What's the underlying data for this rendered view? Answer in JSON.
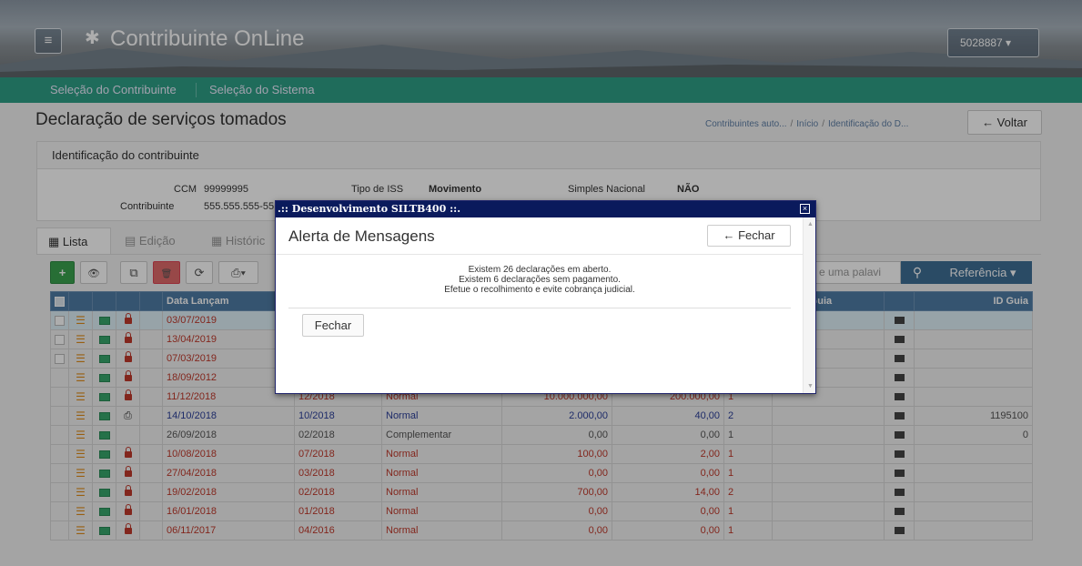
{
  "header": {
    "brand": "Contribuinte OnLine",
    "user": "5028887 ▾",
    "menu_icon": "menu-icon",
    "gear_icon": "gear-icon"
  },
  "subnav": {
    "item1": "Seleção do Contribuinte",
    "item2": "Seleção do Sistema"
  },
  "page": {
    "title": "Declaração de serviços tomados",
    "breadcrumb": [
      "Contribuintes auto...",
      "Início",
      "Identificação do D..."
    ],
    "back_label": "← Voltar"
  },
  "panel": {
    "title": "Identificação do contribuinte",
    "ccm_label": "CCM",
    "ccm_value": "99999995",
    "contribuinte_label": "Contribuinte",
    "contribuinte_value": "555.555.555-55",
    "tipo_iss_label": "Tipo de ISS",
    "tipo_iss_value": "Movimento",
    "simples_label": "Simples Nacional",
    "simples_value": "NÃO"
  },
  "tabs": {
    "lista": "Lista",
    "edicao": "Edição",
    "historico": "Históric"
  },
  "toolbar": {
    "search_placeholder": "e uma palavi",
    "ref_label": "Referência ▾",
    "add": "+",
    "view": "👁",
    "copy": "⧉",
    "delete": "🗑",
    "refresh": "⟳",
    "print": "⎙▾"
  },
  "grid": {
    "headers": {
      "data": "Data Lançam",
      "status": "Status Guia",
      "id": "ID Guia"
    },
    "rows": [
      {
        "data": "03/07/2019",
        "ref": "",
        "tipo": "",
        "valor": "",
        "iss": "",
        "n": "",
        "id": "",
        "color": "red",
        "sel": true,
        "chk": true,
        "lock": true,
        "print": false
      },
      {
        "data": "13/04/2019",
        "ref": "",
        "tipo": "",
        "valor": "",
        "iss": "",
        "n": "",
        "id": "",
        "color": "red",
        "sel": false,
        "chk": true,
        "lock": true,
        "print": false
      },
      {
        "data": "07/03/2019",
        "ref": "",
        "tipo": "",
        "valor": "",
        "iss": "",
        "n": "",
        "id": "",
        "color": "red",
        "sel": false,
        "chk": true,
        "lock": true,
        "print": false
      },
      {
        "data": "18/09/2012",
        "ref": "",
        "tipo": "",
        "valor": "",
        "iss": "",
        "n": "",
        "id": "",
        "color": "red",
        "sel": false,
        "chk": false,
        "lock": true,
        "print": false
      },
      {
        "data": "11/12/2018",
        "ref": "12/2018",
        "tipo": "Normal",
        "valor": "10.000.000,00",
        "iss": "200.000,00",
        "n": "1",
        "id": "",
        "color": "red",
        "sel": false,
        "chk": false,
        "lock": true,
        "print": false
      },
      {
        "data": "14/10/2018",
        "ref": "10/2018",
        "tipo": "Normal",
        "valor": "2.000,00",
        "iss": "40,00",
        "n": "2",
        "id": "1195100",
        "color": "blue",
        "sel": false,
        "chk": false,
        "lock": false,
        "print": true
      },
      {
        "data": "26/09/2018",
        "ref": "02/2018",
        "tipo": "Complementar",
        "valor": "0,00",
        "iss": "0,00",
        "n": "1",
        "id": "0",
        "color": "gray",
        "sel": false,
        "chk": false,
        "lock": false,
        "print": false
      },
      {
        "data": "10/08/2018",
        "ref": "07/2018",
        "tipo": "Normal",
        "valor": "100,00",
        "iss": "2,00",
        "n": "1",
        "id": "",
        "color": "red",
        "sel": false,
        "chk": false,
        "lock": true,
        "print": false
      },
      {
        "data": "27/04/2018",
        "ref": "03/2018",
        "tipo": "Normal",
        "valor": "0,00",
        "iss": "0,00",
        "n": "1",
        "id": "",
        "color": "red",
        "sel": false,
        "chk": false,
        "lock": true,
        "print": false
      },
      {
        "data": "19/02/2018",
        "ref": "02/2018",
        "tipo": "Normal",
        "valor": "700,00",
        "iss": "14,00",
        "n": "2",
        "id": "",
        "color": "red",
        "sel": false,
        "chk": false,
        "lock": true,
        "print": false
      },
      {
        "data": "16/01/2018",
        "ref": "01/2018",
        "tipo": "Normal",
        "valor": "0,00",
        "iss": "0,00",
        "n": "1",
        "id": "",
        "color": "red",
        "sel": false,
        "chk": false,
        "lock": true,
        "print": false
      },
      {
        "data": "06/11/2017",
        "ref": "04/2016",
        "tipo": "Normal",
        "valor": "0,00",
        "iss": "0,00",
        "n": "1",
        "id": "",
        "color": "red",
        "sel": false,
        "chk": false,
        "lock": true,
        "print": false
      }
    ]
  },
  "modal": {
    "bar_title": ".:: Desenvolvimento SILTB400 ::.",
    "title": "Alerta de Mensagens",
    "close_top": "← Fechar",
    "msg1": "Existem 26 declarações em aberto.",
    "msg2": "Existem 6 declarações sem pagamento.",
    "msg3": "Efetue o recolhimento e evite cobrança judicial.",
    "close_bottom": "Fechar",
    "x": "×"
  }
}
